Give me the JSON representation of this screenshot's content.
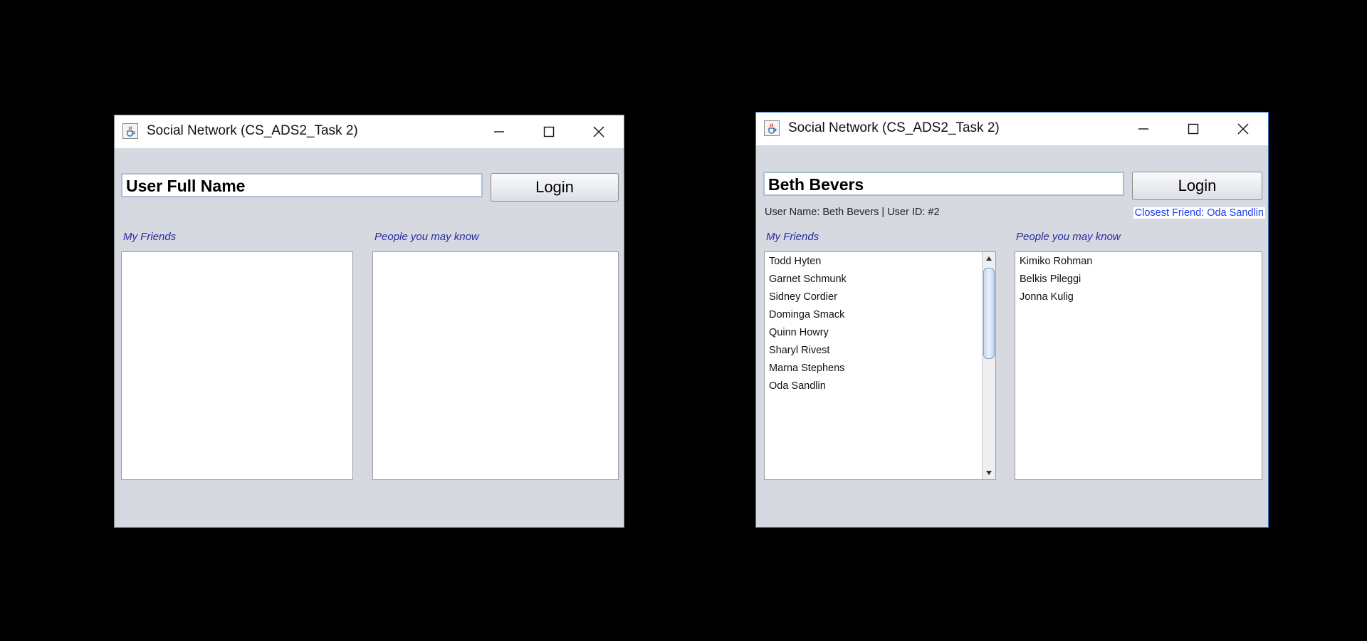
{
  "windows": [
    {
      "title": "Social Network (CS_ADS2_Task 2)",
      "name_value": "User Full Name",
      "login_label": "Login",
      "friends_label": "My Friends",
      "suggest_label": "People you may know",
      "friends": [],
      "suggestions": []
    },
    {
      "title": "Social Network (CS_ADS2_Task 2)",
      "name_value": "Beth Bevers",
      "login_label": "Login",
      "user_info": "User Name: Beth Bevers | User ID: #2",
      "closest_friend": "Closest Friend: Oda Sandlin",
      "friends_label": "My Friends",
      "suggest_label": "People you may know",
      "friends": [
        "Todd Hyten",
        "Garnet Schmunk",
        "Sidney Cordier",
        "Dominga Smack",
        "Quinn Howry",
        "Sharyl Rivest",
        "Marna Stephens",
        "Oda Sandlin"
      ],
      "suggestions": [
        "Kimiko Rohman",
        "Belkis Pileggi",
        "Jonna Kulig"
      ]
    }
  ],
  "icons": {
    "app": "java-cup-icon",
    "minimize": "minimize-icon",
    "maximize": "maximize-icon",
    "close": "close-icon"
  },
  "colors": {
    "window_bg": "#d6d9df",
    "section_label": "#2a2aa0",
    "closest_friend_text": "#1a3cf0"
  }
}
